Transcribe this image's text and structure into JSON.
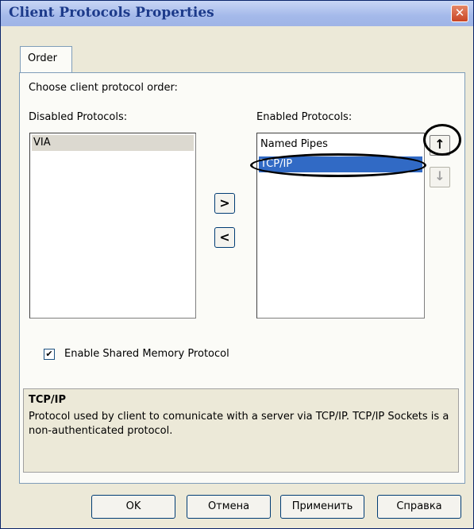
{
  "window": {
    "title": "Client Protocols Properties",
    "close_glyph": "✕"
  },
  "tab": {
    "label": "Order"
  },
  "labels": {
    "choose": "Choose client protocol order:",
    "disabled": "Disabled Protocols:",
    "enabled": "Enabled Protocols:"
  },
  "disabled_list": [
    "VIA"
  ],
  "enabled_list": [
    "Named Pipes",
    "TCP/IP"
  ],
  "move_buttons": {
    "right": ">",
    "left": "<"
  },
  "order_buttons": {
    "up": "↑",
    "down": "↓"
  },
  "shared_memory": {
    "label": "Enable Shared Memory Protocol",
    "checked": true,
    "check_glyph": "✔"
  },
  "description": {
    "title": "TCP/IP",
    "text": "Protocol used by client to comunicate with a server via TCP/IP. TCP/IP Sockets is a non-authenticated protocol."
  },
  "buttons": {
    "ok": "OK",
    "cancel": "Отмена",
    "apply": "Применить",
    "help": "Справка"
  },
  "colors": {
    "selection": "#316ac5",
    "title_bar": "#a4b9ea",
    "close": "#c94524"
  }
}
